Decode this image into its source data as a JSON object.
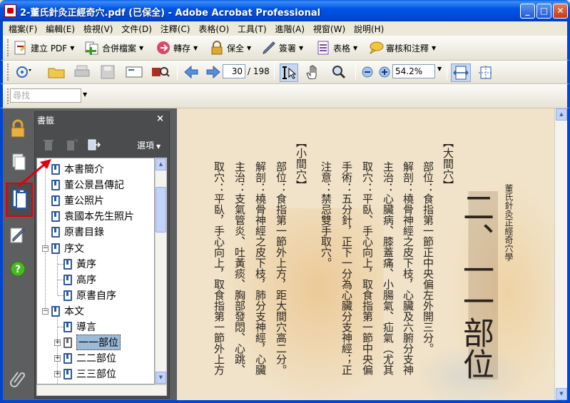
{
  "window": {
    "title": "2-董氏針灸正經奇穴.pdf (已保全) - Adobe Acrobat Professional",
    "min_label": "_",
    "max_label": "□",
    "close_label": "✕"
  },
  "menubar": [
    "檔案(F)",
    "編輯(E)",
    "檢視(V)",
    "文件(D)",
    "注釋(C)",
    "表格(O)",
    "工具(T)",
    "進階(A)",
    "視窗(W)",
    "說明(H)"
  ],
  "toolbar1": {
    "create_pdf": "建立 PDF",
    "combine": "合併檔案",
    "export": "轉存",
    "secure": "保全",
    "sign": "簽署",
    "forms": "表格",
    "review": "審核和注釋"
  },
  "toolbar2": {
    "page_current": "30",
    "page_total": "/ 198",
    "zoom": "54.2%"
  },
  "search": {
    "placeholder": "尋找"
  },
  "bookmarks": {
    "title": "書籤",
    "close": "×",
    "options": "選項",
    "items": [
      {
        "label": "本書簡介"
      },
      {
        "label": "董公景昌傳記"
      },
      {
        "label": "董公照片"
      },
      {
        "label": "袁國本先生照片"
      },
      {
        "label": "原書目錄"
      },
      {
        "label": "序文"
      },
      {
        "label": "黃序"
      },
      {
        "label": "高序"
      },
      {
        "label": "原書自序"
      },
      {
        "label": "本文"
      },
      {
        "label": "導言"
      },
      {
        "label": "一一部位"
      },
      {
        "label": "二二部位"
      },
      {
        "label": "三三部位"
      }
    ]
  },
  "document": {
    "running_header": "董氏針灸正經奇穴學",
    "chapter": "二、一一部位",
    "col1": "【大間穴】",
    "col2": "部位：食指第一節正中央偏左外開三分。",
    "col3": "解剖：橈骨神經之皮下枝，心臟及六腑分支神",
    "col4": "主治：心臟病、膝蓋痛、小腸氣、疝氣（尤其",
    "col5": "取穴：平臥、手心向上，取食指第一節中央偏",
    "col6": "手術：五分針，正下一分為心臟分支神經；正",
    "col7": "注意：禁忌雙手取穴。",
    "col8": "【小間穴】",
    "col9": "部位：食指第一節外上方，距大間穴高二分。",
    "col10": "解剖：橈骨神經之皮下枝，肺分支神經，心臟",
    "col11": "主治：支氣管炎、吐黃痰、胸部發悶、心跳、",
    "col12": "取穴：平臥，手心向上，取食指第一節外上方"
  },
  "colors": {
    "title_bar": "#0046d4",
    "nav_rail": "#5c5e60",
    "page_bg": "#f1e3c9",
    "highlight_red": "#e00010"
  }
}
